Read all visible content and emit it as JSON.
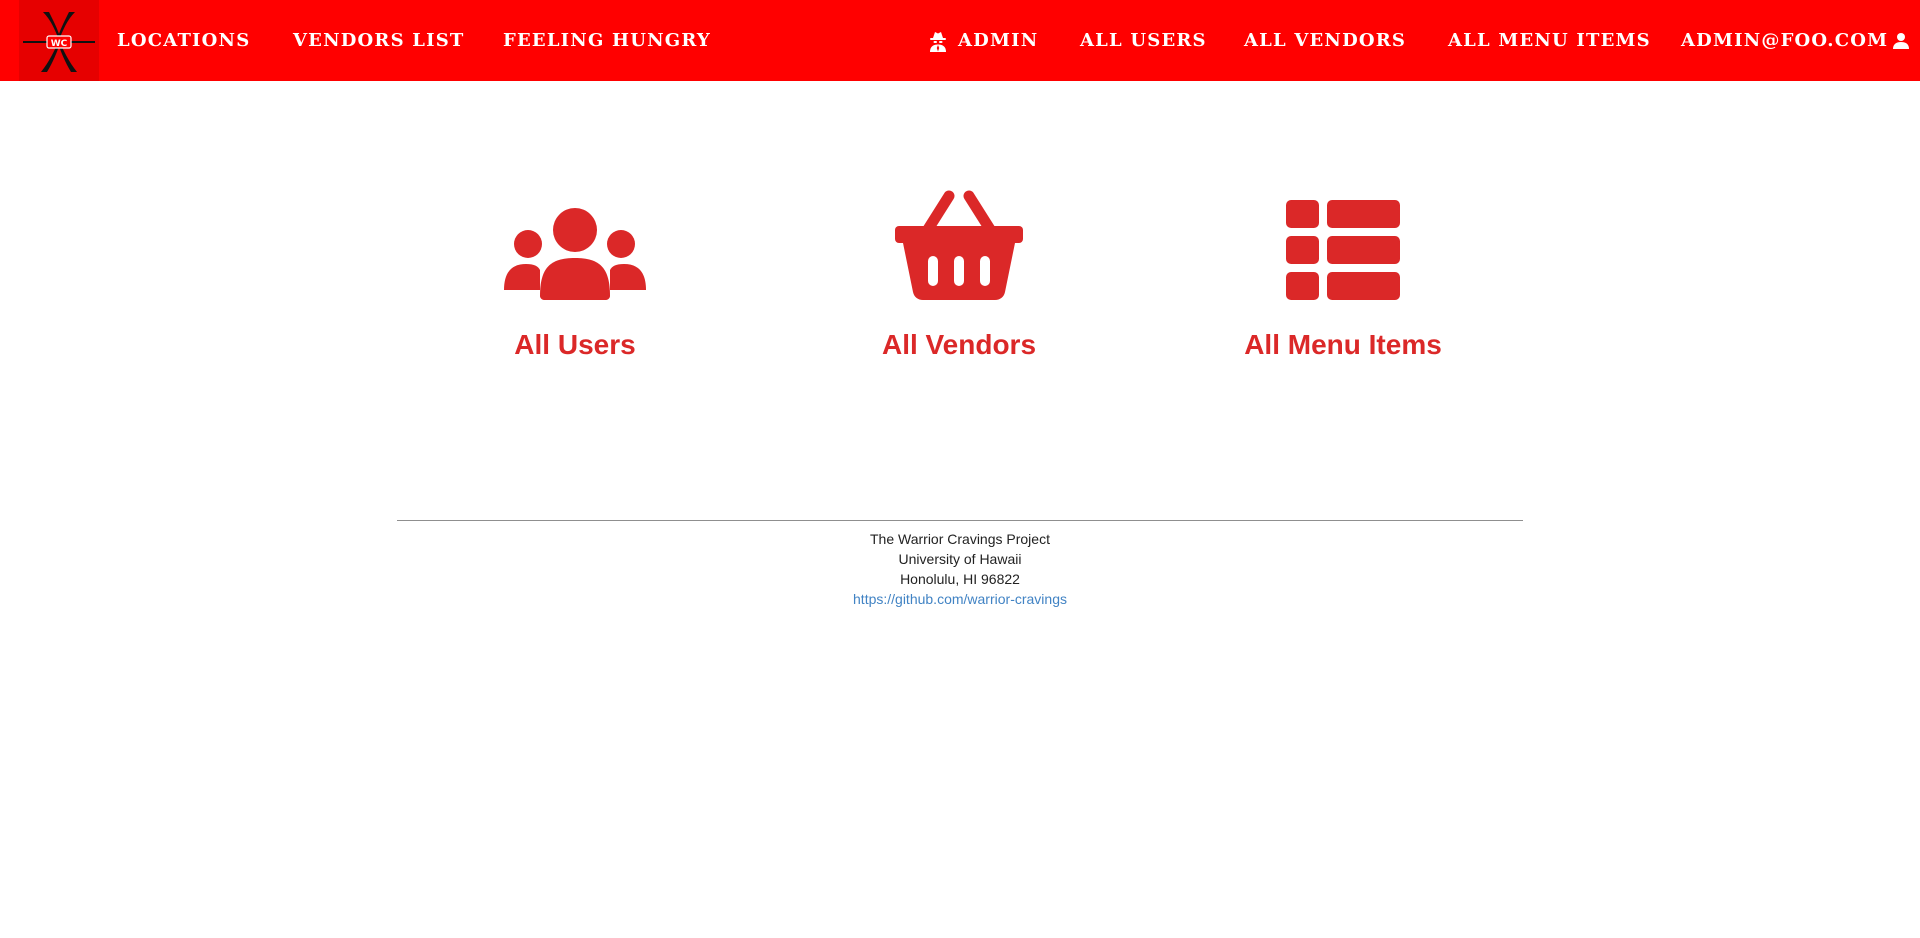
{
  "colors": {
    "navbar": "#ff0000",
    "logo_bg": "#e60000",
    "accent": "#db2828",
    "link": "#4183c4"
  },
  "navbar": {
    "logo": {
      "text": "WC",
      "icon": "warrior-cravings-logo"
    },
    "left_items": [
      {
        "label": "Locations"
      },
      {
        "label": "Vendors List"
      },
      {
        "label": "Feeling Hungry"
      }
    ],
    "right_items": [
      {
        "label": "Admin",
        "icon": "user-secret-icon"
      },
      {
        "label": "All Users"
      },
      {
        "label": "All Vendors"
      },
      {
        "label": "All Menu Items"
      },
      {
        "label": "admin@foo.com",
        "icon": "user-icon"
      }
    ]
  },
  "cards": [
    {
      "label": "All Users",
      "icon": "users-icon"
    },
    {
      "label": "All Vendors",
      "icon": "shopping-basket-icon"
    },
    {
      "label": "All Menu Items",
      "icon": "th-list-icon"
    }
  ],
  "footer": {
    "line1": "The Warrior Cravings Project",
    "line2": "University of Hawaii",
    "line3": "Honolulu, HI 96822",
    "link": "https://github.com/warrior-cravings"
  }
}
